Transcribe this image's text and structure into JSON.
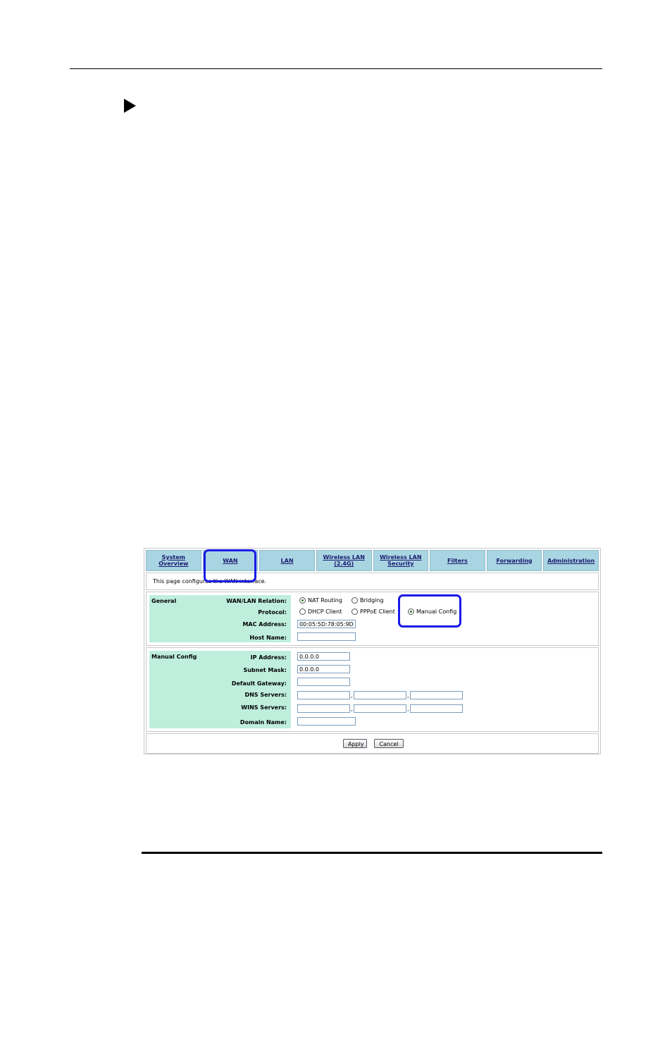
{
  "tabs": [
    {
      "label": "System\nOverview"
    },
    {
      "label": "WAN"
    },
    {
      "label": "LAN"
    },
    {
      "label": "Wireless LAN\n(2.4G)"
    },
    {
      "label": "Wireless LAN\nSecurity"
    },
    {
      "label": "Filters"
    },
    {
      "label": "Forwarding"
    },
    {
      "label": "Administration"
    }
  ],
  "active_tab": "WAN",
  "description": "This page configures the WAN interface.",
  "general": {
    "title": "General",
    "wan_lan_relation_label": "WAN/LAN Relation:",
    "protocol_label": "Protocol:",
    "mac_label": "MAC Address:",
    "host_label": "Host Name:",
    "relation_options": [
      {
        "label": "NAT Routing",
        "selected": true
      },
      {
        "label": "Bridging",
        "selected": false
      }
    ],
    "protocol_options": [
      {
        "label": "DHCP Client",
        "selected": false
      },
      {
        "label": "PPPoE Client",
        "selected": false
      },
      {
        "label": "Manual Config",
        "selected": true
      }
    ],
    "mac_value": "00:05:5D:78:05:9D",
    "host_value": ""
  },
  "manual": {
    "title": "Manual Config",
    "ip_label": "IP Address:",
    "mask_label": "Subnet Mask:",
    "gateway_label": "Default Gateway:",
    "dns_label": "DNS Servers:",
    "wins_label": "WINS Servers:",
    "domain_label": "Domain Name:",
    "ip_value": "0.0.0.0",
    "mask_value": "0.0.0.0",
    "gateway_value": "",
    "separator": ","
  },
  "actions": {
    "apply": "Apply",
    "cancel": "Cancel"
  },
  "colors": {
    "tab_bg": "#a9d5e3",
    "panel_bg": "#bfeedd",
    "highlight": "#1a1ae6"
  }
}
